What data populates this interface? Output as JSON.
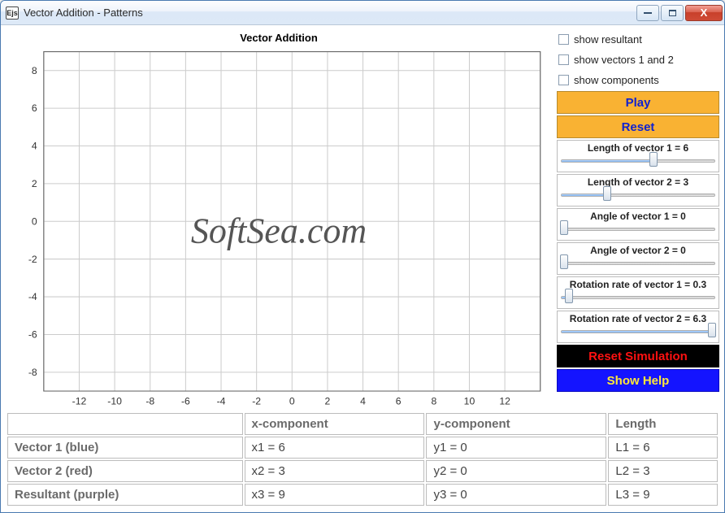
{
  "window": {
    "title": "Vector Addition - Patterns"
  },
  "chart_data": {
    "type": "line",
    "title": "Vector Addition",
    "xlabel": "",
    "ylabel": "",
    "x_ticks": [
      -12,
      -10,
      -8,
      -6,
      -4,
      -2,
      0,
      2,
      4,
      6,
      8,
      10,
      12
    ],
    "y_ticks": [
      -8,
      -6,
      -4,
      -2,
      0,
      2,
      4,
      6,
      8
    ],
    "xlim": [
      -14,
      14
    ],
    "ylim": [
      -9,
      9
    ],
    "series": []
  },
  "watermark": "SoftSea.com",
  "side": {
    "checkboxes": [
      {
        "label": "show resultant"
      },
      {
        "label": "show vectors 1 and 2"
      },
      {
        "label": "show components"
      }
    ],
    "play": "Play",
    "reset": "Reset",
    "sliders": [
      {
        "label": "Length of vector 1 = 6",
        "pos": 0.6
      },
      {
        "label": "Length of vector 2 = 3",
        "pos": 0.3
      },
      {
        "label": "Angle of vector 1 = 0",
        "pos": 0.02
      },
      {
        "label": "Angle of vector 2 = 0",
        "pos": 0.02
      },
      {
        "label": "Rotation rate of vector 1 = 0.3",
        "pos": 0.05
      },
      {
        "label": "Rotation rate of vector 2 = 6.3",
        "pos": 0.98
      }
    ],
    "reset_sim": "Reset Simulation",
    "show_help": "Show Help"
  },
  "table": {
    "headers": [
      "",
      "x-component",
      "y-component",
      "Length"
    ],
    "rows": [
      {
        "name": "Vector 1 (blue)",
        "x": "x1 = 6",
        "y": "y1 = 0",
        "l": "L1 = 6"
      },
      {
        "name": "Vector 2 (red)",
        "x": "x2 = 3",
        "y": "y2 = 0",
        "l": "L2 = 3"
      },
      {
        "name": "Resultant (purple)",
        "x": "x3 = 9",
        "y": "y3 = 0",
        "l": "L3 = 9"
      }
    ]
  }
}
